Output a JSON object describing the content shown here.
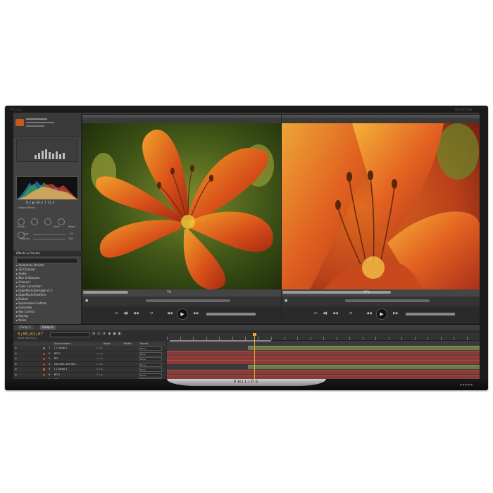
{
  "monitor": {
    "brand_top_left": "Philips",
    "brand_top_right": "UltraClear",
    "logo": "PHILIPS",
    "bezel_bottom_right": "■ ■ ■ ■ ■"
  },
  "left_panel": {
    "readout": "9.2  ◐ 60.2  7  72.4",
    "original_photo_label": "Original Photo",
    "brush_label": "Brush",
    "clear_label": "Clear",
    "reset_label": "Reset",
    "size_label": "Size",
    "size_value": "25",
    "opacity_label": "Opacity",
    "opacity_value": "100",
    "effects_panel_title": "Effects & Presets",
    "effects_list": [
      "▸ Animation Presets",
      "▸ 3D Channel",
      "▸ Audio",
      "▸ Blur & Sharpen",
      "▸ Channel",
      "▸ Color Correction",
      "▸ DigieffectsDamage v2.5",
      "▸ DigieffectsFreeform",
      "▸ Distort",
      "▸ Expression Controls",
      "▸ Generate",
      "▸ Key Correct",
      "▸ Keying",
      "▸ Noise"
    ]
  },
  "viewer_left": {
    "zoom": "7%",
    "scrub_fraction": 0.23
  },
  "viewer_right": {
    "zoom": "47%",
    "scrub_fraction": 0.55
  },
  "timeline": {
    "tabs": [
      "Comp 1",
      "Comp 2"
    ],
    "active_tab": 1,
    "timecode": "0;00;02;07",
    "frame_info": "00067 (29.97 fps)",
    "headers": {
      "source_name": "Source Name",
      "mode": "Mode",
      "trkmat": "TrkMat",
      "parent": "Parent"
    },
    "layers": [
      {
        "num": "1",
        "name": "[ ] Comp 2",
        "mode": "None",
        "label_color": "#d26b2b"
      },
      {
        "num": "2",
        "name": "BG 2",
        "mode": "None",
        "label_color": "#c23b3b"
      },
      {
        "num": "3",
        "name": "BG",
        "mode": "None",
        "label_color": "#c23b3b"
      },
      {
        "num": "4",
        "name": "you bee..ove me...",
        "mode": "None",
        "label_color": "#c23b3b"
      },
      {
        "num": "5",
        "name": "[ ] Comp 1",
        "mode": "None",
        "label_color": "#d26b2b"
      },
      {
        "num": "6",
        "name": "BG 2",
        "mode": "None",
        "label_color": "#c23b3b"
      },
      {
        "num": "7",
        "name": "BG",
        "mode": "None",
        "label_color": "#c23b3b"
      }
    ],
    "playhead_fraction": 0.28,
    "colors": {
      "timecode": "#e7a63d",
      "layer_bar": "#8b3a37",
      "layer_bar_green": "#6d7a4a"
    }
  }
}
